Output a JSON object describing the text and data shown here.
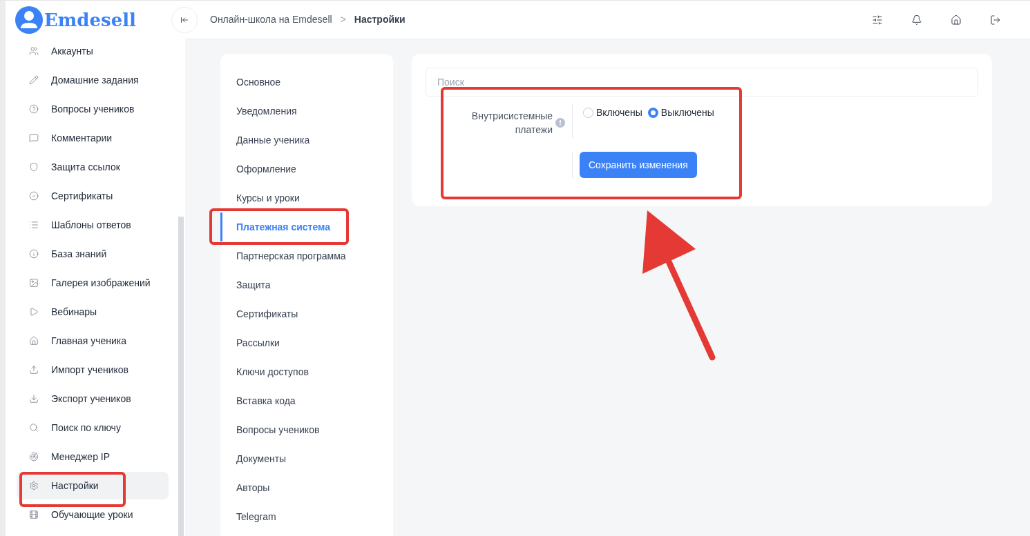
{
  "logo": {
    "text": "Emdesell"
  },
  "sidebar": {
    "items": [
      {
        "label": "Аккаунты",
        "selected": false
      },
      {
        "label": "Домашние задания",
        "selected": false
      },
      {
        "label": "Вопросы учеников",
        "selected": false
      },
      {
        "label": "Комментарии",
        "selected": false
      },
      {
        "label": "Защита ссылок",
        "selected": false
      },
      {
        "label": "Сертификаты",
        "selected": false
      },
      {
        "label": "Шаблоны ответов",
        "selected": false
      },
      {
        "label": "База знаний",
        "selected": false
      },
      {
        "label": "Галерея изображений",
        "selected": false
      },
      {
        "label": "Вебинары",
        "selected": false
      },
      {
        "label": "Главная ученика",
        "selected": false
      },
      {
        "label": "Импорт учеников",
        "selected": false
      },
      {
        "label": "Экспорт учеников",
        "selected": false
      },
      {
        "label": "Поиск по ключу",
        "selected": false
      },
      {
        "label": "Менеджер IP",
        "selected": false
      },
      {
        "label": "Настройки",
        "selected": true
      },
      {
        "label": "Обучающие уроки",
        "selected": false
      }
    ]
  },
  "breadcrumb": [
    "Онлайн-школа на Emdesell",
    "Настройки"
  ],
  "breadcrumb_separator": ">",
  "settings_nav": [
    {
      "label": "Основное",
      "selected": false
    },
    {
      "label": "Уведомления",
      "selected": false
    },
    {
      "label": "Данные ученика",
      "selected": false
    },
    {
      "label": "Оформление",
      "selected": false
    },
    {
      "label": "Курсы и уроки",
      "selected": false
    },
    {
      "label": "Платежная система",
      "selected": true
    },
    {
      "label": "Партнерская программа",
      "selected": false
    },
    {
      "label": "Защита",
      "selected": false
    },
    {
      "label": "Сертификаты",
      "selected": false
    },
    {
      "label": "Рассылки",
      "selected": false
    },
    {
      "label": "Ключи доступов",
      "selected": false
    },
    {
      "label": "Вставка кода",
      "selected": false
    },
    {
      "label": "Вопросы учеников",
      "selected": false
    },
    {
      "label": "Документы",
      "selected": false
    },
    {
      "label": "Авторы",
      "selected": false
    },
    {
      "label": "Telegram",
      "selected": false
    }
  ],
  "search": {
    "placeholder": "Поиск"
  },
  "setting": {
    "label": "Внутрисистемные платежи",
    "options": [
      {
        "label": "Включены",
        "selected": false
      },
      {
        "label": "Выключены",
        "selected": true
      }
    ]
  },
  "save_button": "Сохранить изменения"
}
